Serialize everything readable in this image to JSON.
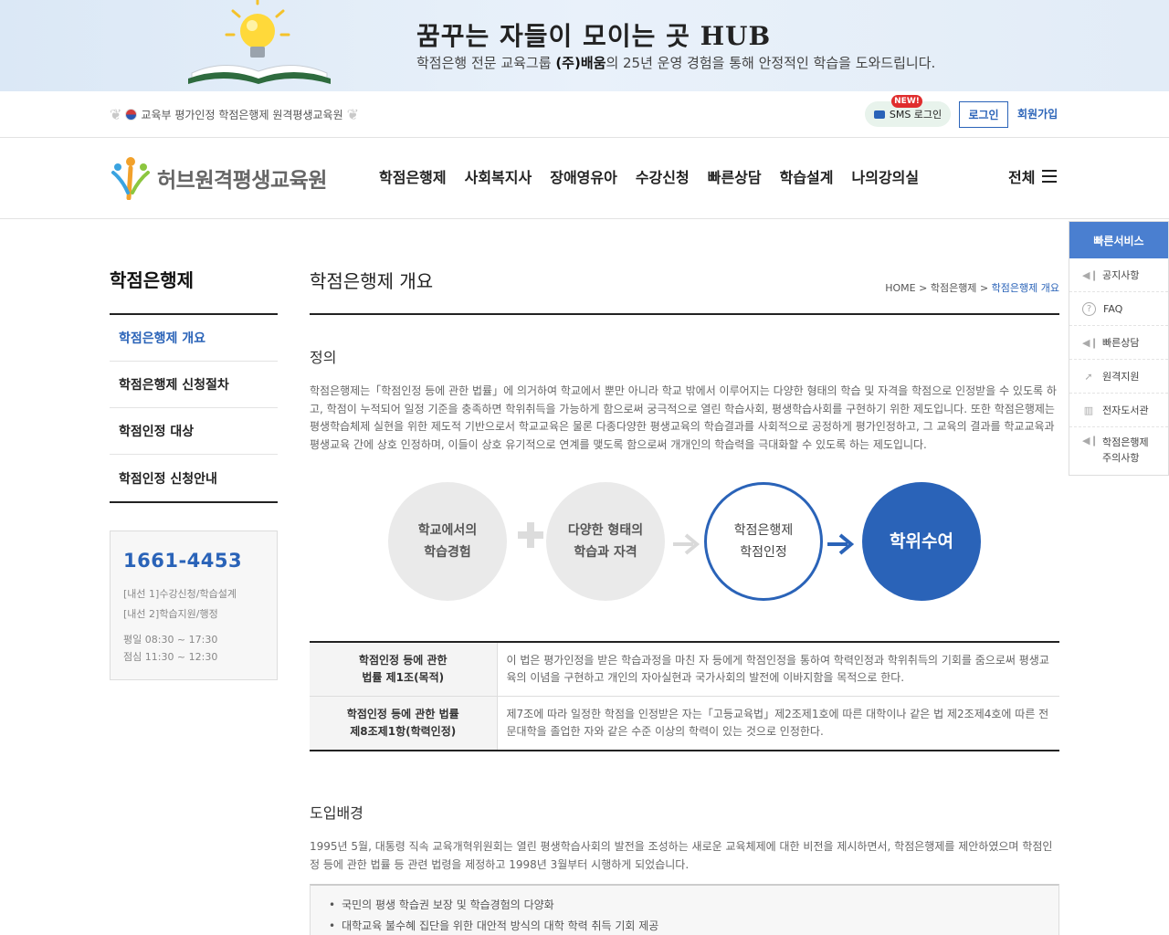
{
  "banner": {
    "title": "꿈꾸는 자들이 모이는 곳 HUB",
    "subtitle_pre": "학점은행 전문 교육그룹 ",
    "subtitle_brand": "(주)배움",
    "subtitle_post": "의 25년 운영 경험을 통해 안정적인 학습을 도와드립니다."
  },
  "util": {
    "accreditation": "교육부 평가인정 학점은행제 원격평생교육원",
    "new_badge": "NEW!",
    "sms_login": "SMS 로그인",
    "login": "로그인",
    "join": "회원가입"
  },
  "header": {
    "logo_text": "허브원격평생교육원",
    "nav": [
      "학점은행제",
      "사회복지사",
      "장애영유아",
      "수강신청",
      "빠른상담",
      "학습설계",
      "나의강의실"
    ],
    "all_menu": "전체"
  },
  "sidebar": {
    "title": "학점은행제",
    "items": [
      "학점은행제 개요",
      "학점은행제 신청절차",
      "학점인정 대상",
      "학점인정 신청안내"
    ],
    "active_index": 0,
    "contact": {
      "phone": "1661-4453",
      "line1": "[내선 1]수강신청/학습설계",
      "line2": "[내선 2]학습지원/행정",
      "hours_weekday": "평일 08:30 ~ 17:30",
      "hours_lunch": "점심 11:30 ~ 12:30"
    }
  },
  "content": {
    "page_title": "학점은행제 개요",
    "breadcrumb": {
      "home": "HOME",
      "section": "학점은행제",
      "current": "학점은행제 개요",
      "sep": ">"
    },
    "definition": {
      "title": "정의",
      "text": "학점은행제는「학점인정 등에 관한 법률」에 의거하여 학교에서 뿐만 아니라 학교 밖에서 이루어지는 다양한 형태의 학습 및 자격을 학점으로 인정받을 수 있도록 하고, 학점이 누적되어 일정 기준을 충족하면 학위취득을 가능하게 함으로써 궁극적으로 열린 학습사회, 평생학습사회를 구현하기 위한 제도입니다. 또한 학점은행제는 평생학습체제 실현을 위한 제도적 기반으로서 학교교육은 물론 다종다양한 평생교육의 학습결과를 사회적으로 공정하게 평가인정하고, 그 교육의 결과를 학교교육과 평생교육 간에 상호 인정하며, 이들이 상호 유기적으로 연계를 맺도록 함으로써 개개인의 학습력을 극대화할 수 있도록 하는 제도입니다."
    },
    "diagram": {
      "circle1": [
        "학교에서의",
        "학습경험"
      ],
      "circle2": [
        "다양한 형태의",
        "학습과 자격"
      ],
      "circle3": [
        "학점은행제",
        "학점인정"
      ],
      "circle4": "학위수여"
    },
    "law_table": [
      {
        "head": [
          "학점인정 등에 관한",
          "법률 제1조(목적)"
        ],
        "body": "이 법은 평가인정을 받은 학습과정을 마친 자 등에게 학점인정을 통하여 학력인정과 학위취득의 기회를 줌으로써 평생교육의 이념을 구현하고 개인의 자아실현과 국가사회의 발전에 이바지함을 목적으로 한다."
      },
      {
        "head": [
          "학점인정 등에 관한 법률",
          "제8조제1항(학력인정)"
        ],
        "body": "제7조에 따라 일정한 학점을 인정받은 자는「고등교육법」제2조제1호에 따른 대학이나 같은 법 제2조제4호에 따른 전문대학을 졸업한 자와 같은 수준 이상의 학력이 있는 것으로 인정한다."
      }
    ],
    "background": {
      "title": "도입배경",
      "text": "1995년 5월, 대통령 직속 교육개혁위원회는 열린 평생학습사회의 발전을 조성하는 새로운 교육체제에 대한 비전을 제시하면서, 학점은행제를 제안하였으며 학점인정 등에 관한 법률 등 관련 법령을 제정하고 1998년 3월부터 시행하게 되었습니다.",
      "bullets": [
        "국민의 평생 학습권 보장 및 학습경험의 다양화",
        "대학교육 불수혜 집단을 위한 대안적 방식의 대학 학력 취득 기회 제공"
      ]
    }
  },
  "quick": {
    "title": "빠른서비스",
    "items": [
      {
        "label": "공지사항",
        "icon": "speaker-icon"
      },
      {
        "label": "FAQ",
        "icon": "question-icon"
      },
      {
        "label": "빠른상담",
        "icon": "speaker-icon"
      },
      {
        "label": "원격지원",
        "icon": "cursor-icon"
      },
      {
        "label": "전자도서관",
        "icon": "library-icon"
      },
      {
        "label": "학점은행제 주의사항",
        "label_line1": "학점은행제",
        "label_line2": "주의사항",
        "icon": "speaker-icon"
      }
    ]
  },
  "colors": {
    "primary": "#2a63b8",
    "quick_head": "#4a7fd0",
    "banner_bg": "#e2ecf7"
  }
}
